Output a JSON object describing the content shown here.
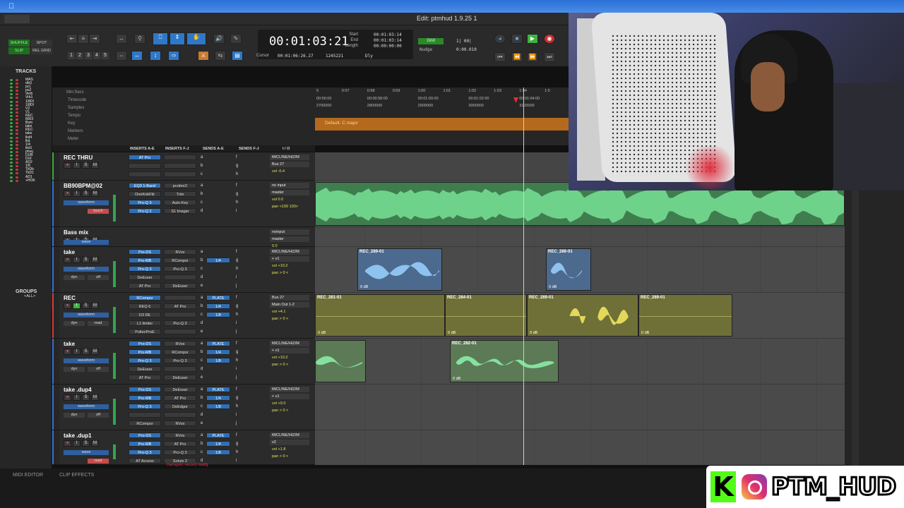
{
  "window_title": "Edit: ptmhud 1.9.25 1",
  "toolbar": {
    "modes": [
      "SHUFFLE",
      "SPOT",
      "SLIP",
      "REL GRID"
    ],
    "zoom_numbers": [
      "1",
      "2",
      "3",
      "4",
      "5"
    ],
    "counter_main": "00:01:03:21",
    "start_label": "Start",
    "end_label": "End",
    "length_label": "Length",
    "start_val": "00:01:03:14",
    "end_val": "00:01:03:14",
    "length_val": "00:00:00:00",
    "cursor_label": "Cursor",
    "cursor_val": "00:01:06:26.27",
    "samples_val": "1245221",
    "dly_label": "Dly",
    "grid_label": "Grid",
    "grid_val": "1| 00|",
    "nudge_label": "Nudge",
    "nudge_val": "0:00.010"
  },
  "tracks_panel": {
    "title": "TRACKS",
    "items": [
      "MAS",
      "dbl1",
      "pc1",
      "po2",
      "Verb",
      "Vrb1",
      "1/8DI",
      "1/8DI",
      "V2",
      "V1",
      "REC",
      "8003",
      "Bsm",
      "take",
      "REC",
      "take",
      "lkd4",
      "lkd",
      "1/4",
      "tkd1",
      "phsq",
      "DUB",
      "DUI",
      "AD2",
      "1/8",
      "TkDb",
      "TkD1",
      "AD1",
      "+HOK"
    ]
  },
  "groups_panel": {
    "title": "GROUPS",
    "item": "<ALL>"
  },
  "ruler": {
    "rows": [
      "Min:Secs",
      "Timecode",
      "Samples",
      "Tempo",
      "Key",
      "Markers",
      "Meter"
    ],
    "min_ticks": [
      "5",
      "0:57",
      "0:58",
      "0:59",
      "1:00",
      "1:01",
      "1:02",
      "1:03",
      "1:04",
      "1:0"
    ],
    "tc_ticks": [
      "00:56:00",
      "00:00:58:00",
      "00:01:00:00",
      "00:01:02:00",
      "00:01:04:00"
    ],
    "sample_ticks": [
      "2700000",
      "2800000",
      "2900000",
      "3000000",
      "3100000"
    ],
    "key_label": "Default: C major"
  },
  "column_headers": [
    "INSERTS A-E",
    "INSERTS F-J",
    "SENDS A-E",
    "SENDS F-J",
    "I / O"
  ],
  "tracks": [
    {
      "name": "REC THRU",
      "inserts": [
        "AT Pro",
        "",
        ""
      ],
      "inserts2": [
        "",
        "",
        ""
      ],
      "sends": [
        "a",
        "b",
        "c"
      ],
      "sends2": [
        "f",
        "g",
        "h"
      ],
      "io": [
        "MICLINE/HIZ/M",
        "Bus 27",
        "vol -0.4"
      ],
      "mode": ""
    },
    {
      "name": "BB90BPM@02",
      "inserts": [
        "EQ3 1-Band",
        "OneKnbFltr",
        "Pro-Q 3",
        "Pro-Q 2"
      ],
      "inserts2": [
        "pcobre2",
        "Trim",
        "Auto-Key",
        "S1 Imager"
      ],
      "sends": [
        "a",
        "b",
        "c",
        "d"
      ],
      "sends2": [
        "f",
        "g",
        "h",
        "i"
      ],
      "io": [
        "no input",
        "master",
        "vol 0.0",
        "pan <100 100>"
      ],
      "mode": "waveform",
      "auto": "touch"
    },
    {
      "name": "Bass mix",
      "inserts": [],
      "inserts2": [],
      "sends": [],
      "sends2": [],
      "io": [
        "noinput",
        "master",
        "0.0"
      ],
      "mode": "wave"
    },
    {
      "name": "take",
      "inserts": [
        "Pro-DS",
        "Pro-MB",
        "Pro-Q 3",
        "DeEsser",
        "AT Pro"
      ],
      "inserts2": [
        "RVox",
        "RCompsr",
        "Pro-Q 3",
        "",
        "DeEsser"
      ],
      "sends": [
        "a",
        "b",
        "c",
        "d",
        "e"
      ],
      "sends2": [
        "f",
        "g",
        "h",
        "i",
        "j"
      ],
      "sendval": "1/4",
      "io": [
        "MICLINE/HIZ/M",
        "+ v1",
        "vol +10.2",
        "pan > 0 <"
      ],
      "mode": "waveform",
      "dyn": "dyn",
      "off": "off"
    },
    {
      "name": "REC",
      "inserts": [
        "RCompsr",
        "REQ 6",
        "D3 DE",
        "L1 limiter",
        "PultecProE"
      ],
      "inserts2": [
        "",
        "AT Pro",
        "",
        "Pro-Q 3",
        ""
      ],
      "sends": [
        "a",
        "b",
        "c",
        "d",
        "e"
      ],
      "sends2": [
        "f",
        "g",
        "h",
        "i",
        "j"
      ],
      "sendval": "1/4",
      "sendval2": "1/8",
      "sendlabel": "PLATE",
      "io": [
        "Bus 27",
        "Main Out 1-2",
        "vol +4.1",
        "pan > 0 <"
      ],
      "mode": "waveform",
      "dyn": "dyn",
      "off": "read"
    },
    {
      "name": "take",
      "inserts": [
        "Pro-DS",
        "Pro-MB",
        "Pro-Q 3",
        "DeEsser",
        "AT Pro"
      ],
      "inserts2": [
        "RVox",
        "RCompsr",
        "Pro-Q 3",
        "",
        "DeEsser"
      ],
      "sends": [
        "a",
        "b",
        "c",
        "d",
        "e"
      ],
      "sends2": [
        "f",
        "g",
        "h",
        "i",
        "j"
      ],
      "sendval": "1/4",
      "sendval2": "1/8",
      "sendlabel": "PLATE",
      "io": [
        "MICLINE/HIZ/M",
        "+ v1",
        "vol +10.2",
        "pan > 0 <"
      ],
      "mode": "waveform",
      "dyn": "dyn",
      "off": "off"
    },
    {
      "name": "take .dup4",
      "inserts": [
        "Pro-DS",
        "Pro-MB",
        "Pro-Q 3",
        "",
        "RCompsr"
      ],
      "inserts2": [
        "DeEsser",
        "AT Pro",
        "DeEdgor",
        "",
        "RVox"
      ],
      "sends": [
        "a",
        "b",
        "c",
        "d",
        "e"
      ],
      "sends2": [
        "f",
        "g",
        "h",
        "i",
        "j"
      ],
      "sendval": "1/4",
      "sendval2": "1/8",
      "sendlabel": "PLATE",
      "io": [
        "MICLINE/HIZ/M",
        "+ v1",
        "vol +9.0",
        "pan > 0 <"
      ],
      "mode": "waveform",
      "dyn": "dyn",
      "off": "off"
    },
    {
      "name": "take .dup1",
      "inserts": [
        "Pro-DS",
        "Pro-MB",
        "Pro-Q 3",
        "AT Access"
      ],
      "inserts2": [
        "RVox",
        "AT Pro",
        "Pro-Q 3",
        "Solum 2"
      ],
      "sends": [
        "a",
        "b",
        "c",
        "d"
      ],
      "sends2": [
        "f",
        "g",
        "h",
        "i"
      ],
      "sendval": "1/4",
      "sendval2": "1/8",
      "sendlabel": "PLATE",
      "io": [
        "MICLINE/HIZ/M",
        "v2",
        "vol +1.8",
        "pan > 0 <"
      ],
      "mode": "wave",
      "auto": "read"
    }
  ],
  "clips": [
    {
      "name": "REC_289-01",
      "db": "0 dB"
    },
    {
      "name": "REC_286-01",
      "db": "0 dB"
    },
    {
      "name": "REC_281-01",
      "db": "0 dB"
    },
    {
      "name": "REC_284-01",
      "db": "0 dB"
    },
    {
      "name": "REC_289-01",
      "db": "0 dB"
    },
    {
      "name": "REC_289-01",
      "db": "0 dB"
    },
    {
      "name": "REC_282-01",
      "db": "0 dB"
    }
  ],
  "status": "transport record ready",
  "bottom_tabs": [
    "MIDI EDITOR",
    "CLIP EFFECTS"
  ],
  "overlay": {
    "handle": "PTM_HUD",
    "k": "K"
  }
}
